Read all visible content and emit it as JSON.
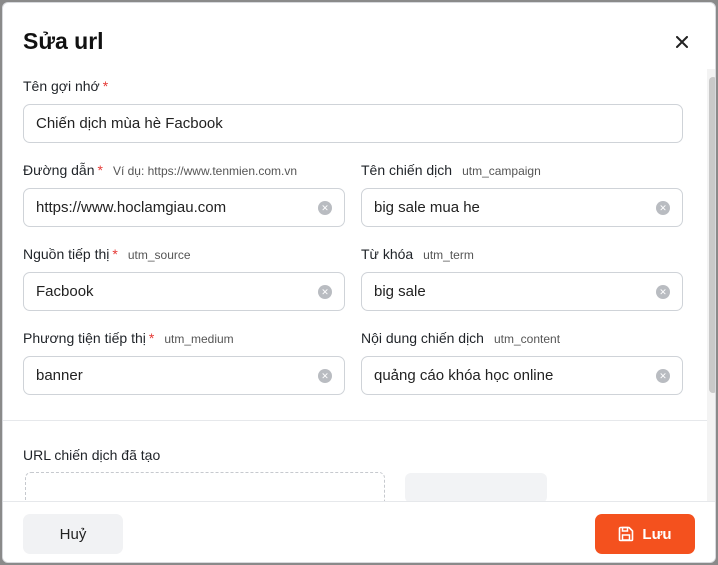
{
  "dialog": {
    "title": "Sửa url"
  },
  "colors": {
    "primary": "#f4511e",
    "required": "#e53935"
  },
  "icons": {
    "close": "close-icon",
    "clear": "clear-icon",
    "save": "floppy-disk-icon"
  },
  "form": {
    "name": {
      "label": "Tên gợi nhớ",
      "required": "*",
      "value": "Chiến dịch mùa hè Facbook"
    },
    "url": {
      "label": "Đường dẫn",
      "required": "*",
      "hint": "Ví dụ: https://www.tenmien.com.vn",
      "value": "https://www.hoclamgiau.com"
    },
    "campaign": {
      "label": "Tên chiến dịch",
      "hint": "utm_campaign",
      "value": "big sale mua he"
    },
    "source": {
      "label": "Nguồn tiếp thị",
      "required": "*",
      "hint": "utm_source",
      "value": "Facbook"
    },
    "term": {
      "label": "Từ khóa",
      "hint": "utm_term",
      "value": "big sale"
    },
    "medium": {
      "label": "Phương tiện tiếp thị",
      "required": "*",
      "hint": "utm_medium",
      "value": "banner"
    },
    "content": {
      "label": "Nội dung chiến dịch",
      "hint": "utm_content",
      "value": "quảng cáo khóa học online"
    }
  },
  "result": {
    "label": "URL chiến dịch đã tạo"
  },
  "footer": {
    "cancel_label": "Huỷ",
    "save_label": "Lưu"
  }
}
